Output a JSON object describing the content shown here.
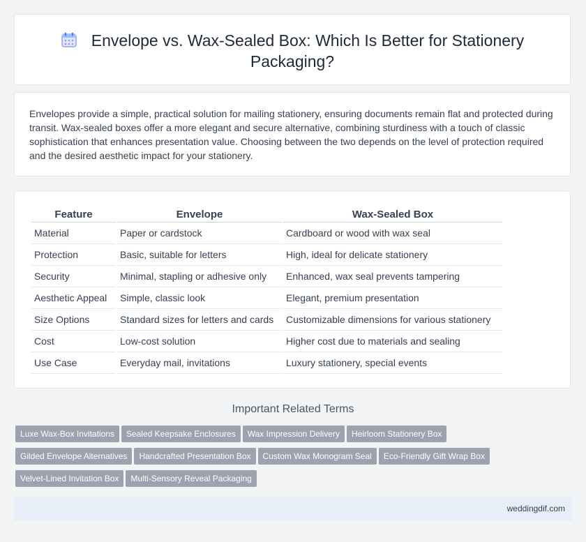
{
  "header": {
    "title": "Envelope vs. Wax-Sealed Box: Which Is Better for Stationery Packaging?",
    "icon": "calendar-icon"
  },
  "intro": {
    "text": "Envelopes provide a simple, practical solution for mailing stationery, ensuring documents remain flat and protected during transit. Wax-sealed boxes offer a more elegant and secure alternative, combining sturdiness with a touch of classic sophistication that enhances presentation value. Choosing between the two depends on the level of protection required and the desired aesthetic impact for your stationery."
  },
  "table": {
    "headers": [
      "Feature",
      "Envelope",
      "Wax-Sealed Box"
    ],
    "rows": [
      [
        "Material",
        "Paper or cardstock",
        "Cardboard or wood with wax seal"
      ],
      [
        "Protection",
        "Basic, suitable for letters",
        "High, ideal for delicate stationery"
      ],
      [
        "Security",
        "Minimal, stapling or adhesive only",
        "Enhanced, wax seal prevents tampering"
      ],
      [
        "Aesthetic Appeal",
        "Simple, classic look",
        "Elegant, premium presentation"
      ],
      [
        "Size Options",
        "Standard sizes for letters and cards",
        "Customizable dimensions for various stationery"
      ],
      [
        "Cost",
        "Low-cost solution",
        "Higher cost due to materials and sealing"
      ],
      [
        "Use Case",
        "Everyday mail, invitations",
        "Luxury stationery, special events"
      ]
    ]
  },
  "related": {
    "title": "Important Related Terms",
    "tags": [
      "Luxe Wax-Box Invitations",
      "Sealed Keepsake Enclosures",
      "Wax Impression Delivery",
      "Heirloom Stationery Box",
      "Gilded Envelope Alternatives",
      "Handcrafted Presentation Box",
      "Custom Wax Monogram Seal",
      "Eco-Friendly Gift Wrap Box",
      "Velvet-Lined Invitation Box",
      "Multi-Sensory Reveal Packaging"
    ]
  },
  "footer": {
    "site": "weddingdif.com"
  },
  "colors": {
    "page_bg": "#f3f4f6",
    "tag_bg": "#9ca3af",
    "footer_bg": "#e8eef8",
    "icon_accent": "#6366f1"
  }
}
